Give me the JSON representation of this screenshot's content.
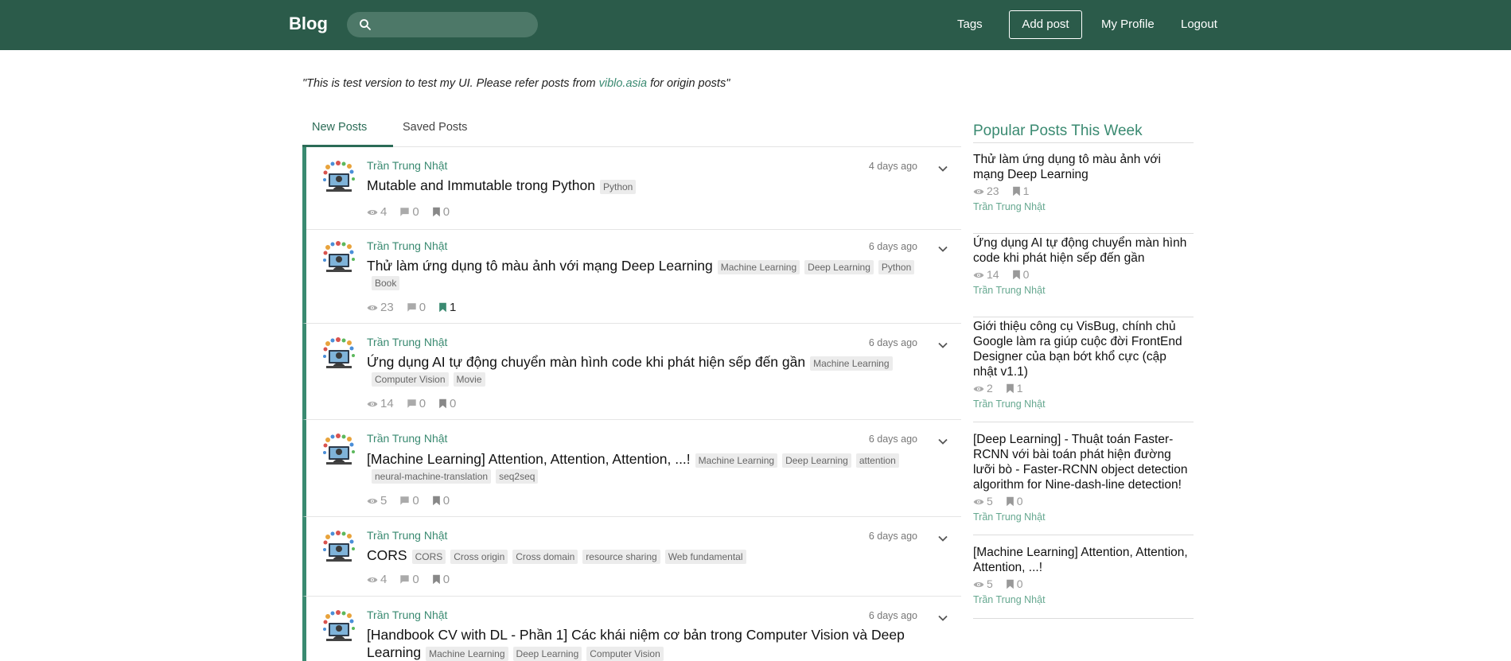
{
  "nav": {
    "brand": "Blog",
    "search_placeholder": "",
    "links": {
      "tags": "Tags",
      "add_post": "Add post",
      "profile": "My Profile",
      "logout": "Logout"
    }
  },
  "notice": {
    "before": "\"This is test version to test my UI. Please refer posts from ",
    "link": "viblo.asia",
    "after": " for origin posts\""
  },
  "tabs": {
    "new": "New Posts",
    "saved": "Saved Posts"
  },
  "posts": [
    {
      "author": "Trần Trung Nhật",
      "time": "4 days ago",
      "title": "Mutable and Immutable trong Python",
      "tags": [
        "Python"
      ],
      "views": "4",
      "comments": "0",
      "bookmarks": "0",
      "bookmarked": false
    },
    {
      "author": "Trần Trung Nhật",
      "time": "6 days ago",
      "title": "Thử làm ứng dụng tô màu ảnh với mạng Deep Learning",
      "tags": [
        "Machine Learning",
        "Deep Learning",
        "Python",
        "Book"
      ],
      "views": "23",
      "comments": "0",
      "bookmarks": "1",
      "bookmarked": true
    },
    {
      "author": "Trần Trung Nhật",
      "time": "6 days ago",
      "title": "Ứng dụng AI tự động chuyển màn hình code khi phát hiện sếp đến gần",
      "tags": [
        "Machine Learning",
        "Computer Vision",
        "Movie"
      ],
      "views": "14",
      "comments": "0",
      "bookmarks": "0",
      "bookmarked": false
    },
    {
      "author": "Trần Trung Nhật",
      "time": "6 days ago",
      "title": "[Machine Learning] Attention, Attention, Attention, ...!",
      "tags": [
        "Machine Learning",
        "Deep Learning",
        "attention",
        "neural-machine-translation",
        "seq2seq"
      ],
      "views": "5",
      "comments": "0",
      "bookmarks": "0",
      "bookmarked": false
    },
    {
      "author": "Trần Trung Nhật",
      "time": "6 days ago",
      "title": "CORS",
      "tags": [
        "CORS",
        "Cross origin",
        "Cross domain",
        "resource sharing",
        "Web fundamental"
      ],
      "views": "4",
      "comments": "0",
      "bookmarks": "0",
      "bookmarked": false
    },
    {
      "author": "Trần Trung Nhật",
      "time": "6 days ago",
      "title": "[Handbook CV with DL - Phần 1] Các khái niệm cơ bản trong Computer Vision và Deep Learning",
      "tags": [
        "Machine Learning",
        "Deep Learning",
        "Computer Vision"
      ],
      "views": "",
      "comments": "",
      "bookmarks": "",
      "bookmarked": false
    }
  ],
  "sidebar": {
    "title": "Popular Posts This Week",
    "items": [
      {
        "title": "Thử làm ứng dụng tô màu ảnh với mạng Deep Learning",
        "views": "23",
        "bookmarks": "1",
        "author": "Trần Trung Nhật"
      },
      {
        "title": "Ứng dụng AI tự động chuyển màn hình code khi phát hiện sếp đến gần",
        "views": "14",
        "bookmarks": "0",
        "author": "Trần Trung Nhật"
      },
      {
        "title": "Giới thiệu công cụ VisBug, chính chủ Google làm ra giúp cuộc đời FrontEnd Designer của bạn bớt khổ cực (cập nhật v1.1)",
        "views": "2",
        "bookmarks": "1",
        "author": "Trần Trung Nhật"
      },
      {
        "title": "[Deep Learning] - Thuật toán Faster-RCNN với bài toán phát hiện đường lưỡi bò - Faster-RCNN object detection algorithm for Nine-dash-line detection!",
        "views": "5",
        "bookmarks": "0",
        "author": "Trần Trung Nhật"
      },
      {
        "title": "[Machine Learning] Attention, Attention, Attention, ...!",
        "views": "5",
        "bookmarks": "0",
        "author": "Trần Trung Nhật"
      }
    ]
  },
  "colors": {
    "nav_bg": "#2b5b4a",
    "accent": "#3a8a71",
    "tag_bg": "#ececec"
  }
}
